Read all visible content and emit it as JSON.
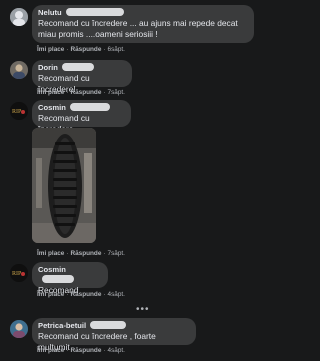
{
  "comments": [
    {
      "name": "Nelutu",
      "text_line1": "Recomand cu încredere ... au ajuns mai repede decat",
      "text_line2": "miau promis ....oameni seriosiii !",
      "like": "Îmi place",
      "reply": "Răspunde",
      "time": "6săpt."
    },
    {
      "name": "Dorin",
      "text": "Recomand cu încredere!",
      "like": "Îmi place",
      "reply": "Răspunde",
      "time": "7săpt."
    },
    {
      "name": "Cosmin",
      "text": "Recomand cu încredere",
      "like": "Îmi place",
      "reply": "Răspunde",
      "time": "7săpt."
    },
    {
      "name": "Cosmin",
      "text": "Recomand",
      "like": "Îmi place",
      "reply": "Răspunde",
      "time": "4săpt."
    },
    {
      "name": "Petrica-betuil",
      "text": "Recomand cu încredere , foarte mulțumit",
      "like": "Îmi place",
      "reply": "Răspunde",
      "time": "4săpt."
    }
  ],
  "more_replies": "•••",
  "avatar_text": "RIP",
  "icons": [
    "avatar-photo",
    "tire-photo"
  ]
}
